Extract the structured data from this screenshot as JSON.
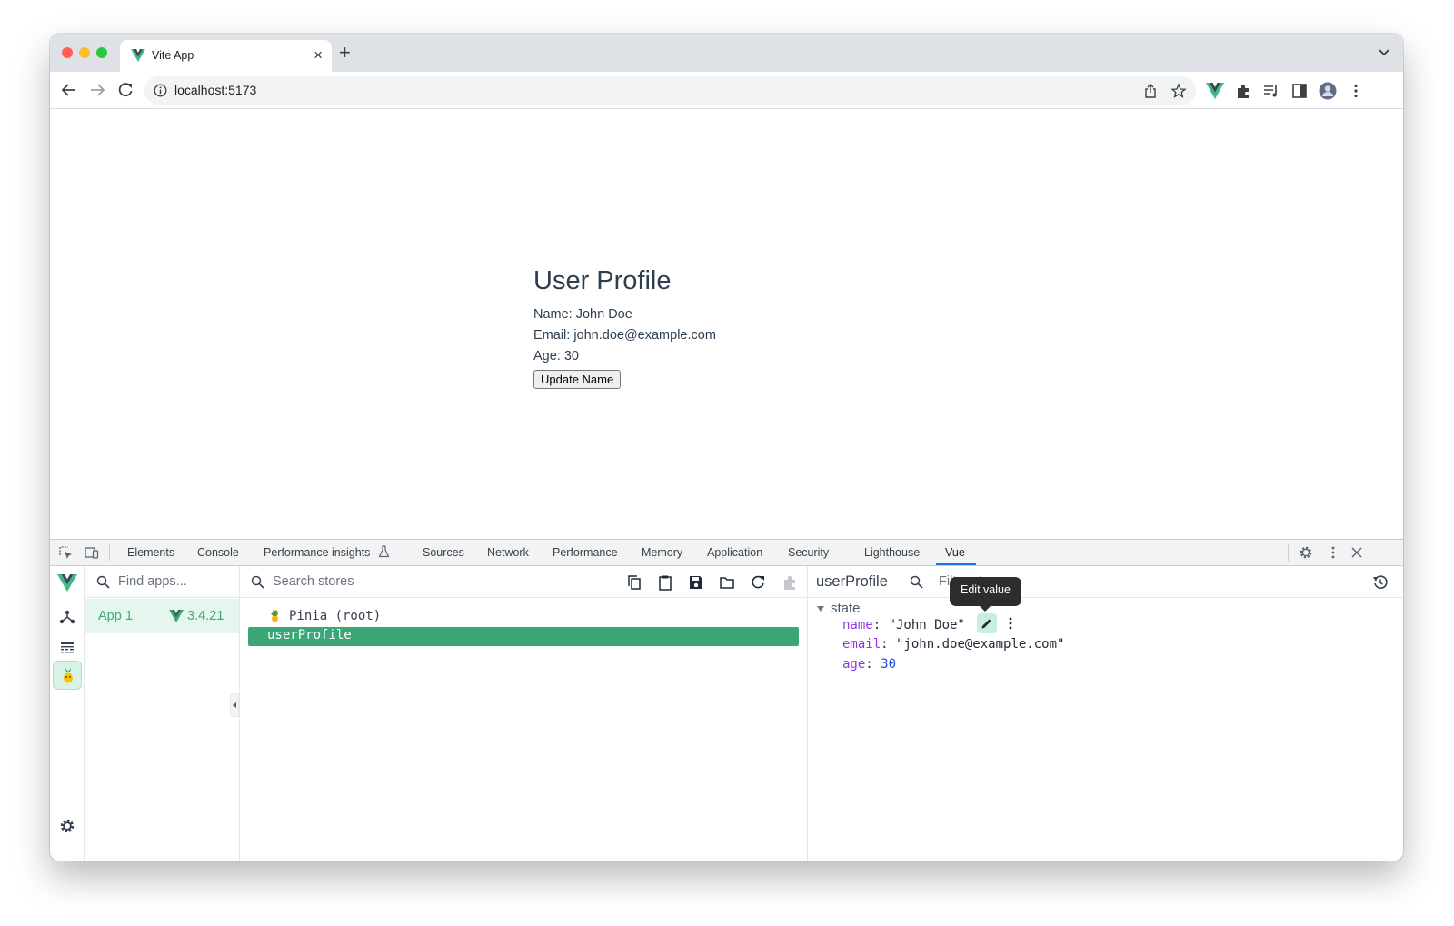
{
  "browser": {
    "tab_title": "Vite App",
    "tab_close": "×",
    "new_tab": "+",
    "url": "localhost:5173"
  },
  "page": {
    "heading": "User Profile",
    "name_line": "Name: John Doe",
    "email_line": "Email: john.doe@example.com",
    "age_line": "Age: 30",
    "button_label": "Update Name"
  },
  "devtools": {
    "tabs": [
      "Elements",
      "Console",
      "Performance insights",
      "Sources",
      "Network",
      "Performance",
      "Memory",
      "Application",
      "Security",
      "Lighthouse",
      "Vue"
    ],
    "active_tab": "Vue",
    "apps": {
      "placeholder": "Find apps...",
      "items": [
        {
          "name": "App 1",
          "version": "3.4.21"
        }
      ]
    },
    "stores": {
      "placeholder": "Search stores",
      "root": "Pinia (root)",
      "selected": "userProfile"
    },
    "state": {
      "store_name": "userProfile",
      "filter_placeholder": "Filter state...",
      "group": "state",
      "tooltip": "Edit value",
      "fields": [
        {
          "key": "name",
          "value": "\"John Doe\""
        },
        {
          "key": "email",
          "value": "\"john.doe@example.com\""
        },
        {
          "key": "age",
          "value": "30"
        }
      ]
    }
  },
  "colors": {
    "vue_green": "#3ba776",
    "vue_green_light": "#e4f6ee",
    "devtools_active_tab": "#1a73e8"
  },
  "icons": [
    "vue-logo-icon",
    "back-arrow-icon",
    "forward-arrow-icon",
    "reload-icon",
    "info-icon",
    "share-icon",
    "star-icon",
    "extensions-icon",
    "tab-search-icon",
    "side-panel-icon",
    "profile-avatar-icon",
    "more-vert-icon",
    "inspect-icon",
    "device-toggle-icon",
    "settings-icon",
    "close-icon",
    "components-icon",
    "timeline-icon",
    "pinia-icon",
    "search-icon",
    "copy-icon",
    "clipboard-icon",
    "save-icon",
    "folder-icon",
    "refresh-icon",
    "plugin-icon",
    "history-icon",
    "edit-icon"
  ]
}
